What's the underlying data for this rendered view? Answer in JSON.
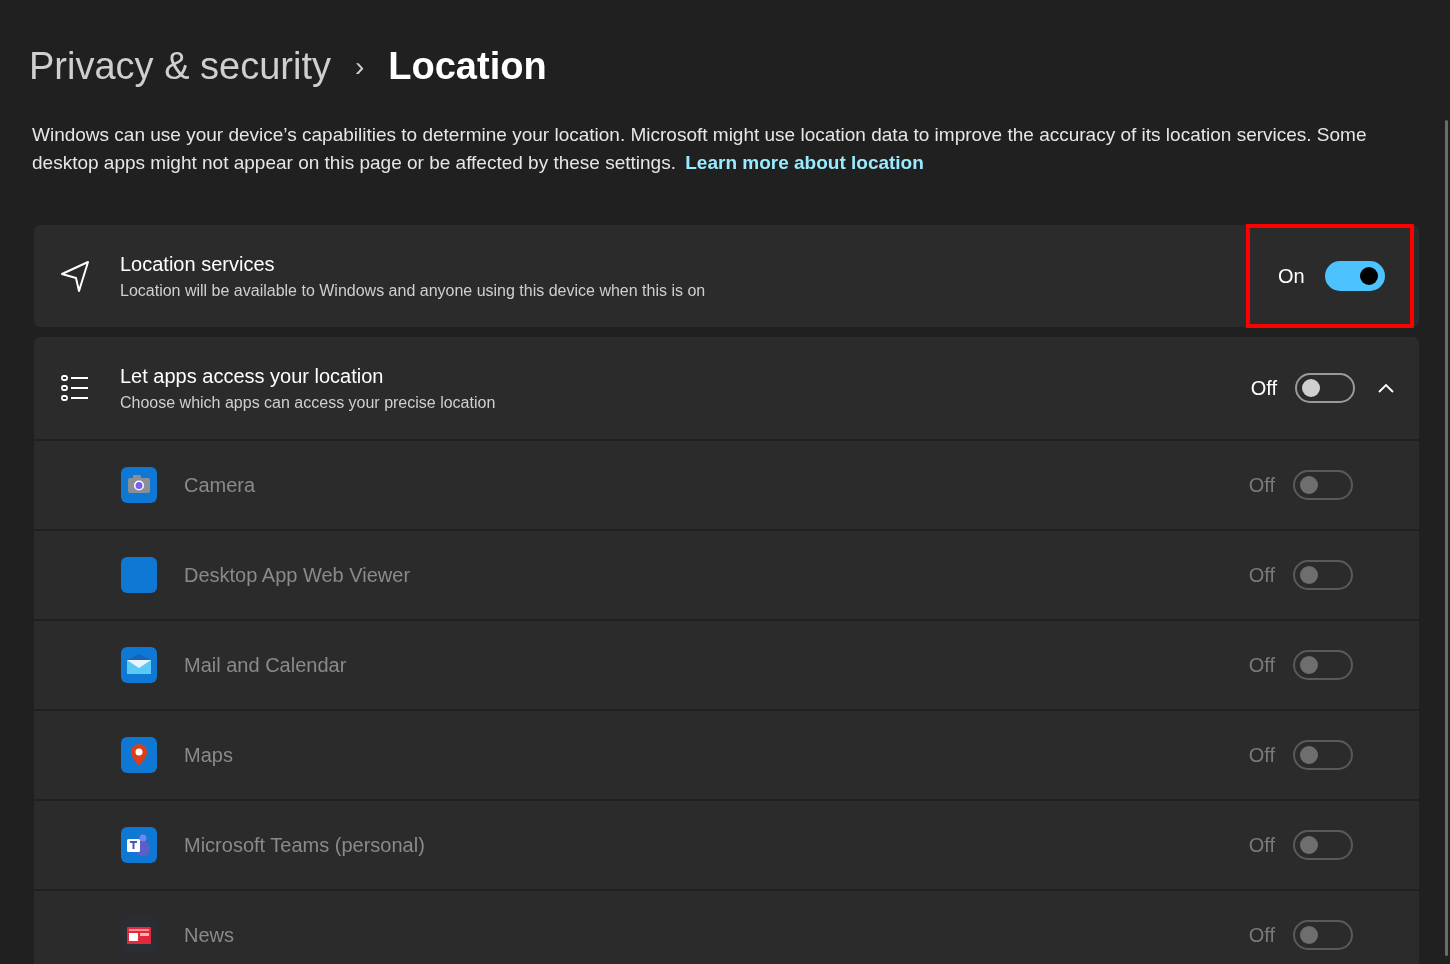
{
  "breadcrumb": {
    "parent": "Privacy & security",
    "separator": "›",
    "current": "Location"
  },
  "description": {
    "text": "Windows can use your device’s capabilities to determine your location. Microsoft might use location data to improve the accuracy of its location services. Some desktop apps might not appear on this page or be affected by these settings.",
    "link": "Learn more about location"
  },
  "location_services": {
    "title": "Location services",
    "subtitle": "Location will be available to Windows and anyone using this device when this is on",
    "state_label": "On",
    "on": true,
    "highlighted": true
  },
  "app_access": {
    "title": "Let apps access your location",
    "subtitle": "Choose which apps can access your precise location",
    "state_label": "Off",
    "on": false,
    "expanded": true,
    "apps": [
      {
        "kind": "camera",
        "name": "Camera",
        "state_label": "Off",
        "on": false,
        "disabled": true
      },
      {
        "kind": "plain",
        "name": "Desktop App Web Viewer",
        "state_label": "Off",
        "on": false,
        "disabled": true
      },
      {
        "kind": "mail",
        "name": "Mail and Calendar",
        "state_label": "Off",
        "on": false,
        "disabled": true
      },
      {
        "kind": "maps",
        "name": "Maps",
        "state_label": "Off",
        "on": false,
        "disabled": true
      },
      {
        "kind": "teams",
        "name": "Microsoft Teams (personal)",
        "state_label": "Off",
        "on": false,
        "disabled": true
      },
      {
        "kind": "news",
        "name": "News",
        "state_label": "Off",
        "on": false,
        "disabled": true
      }
    ]
  }
}
